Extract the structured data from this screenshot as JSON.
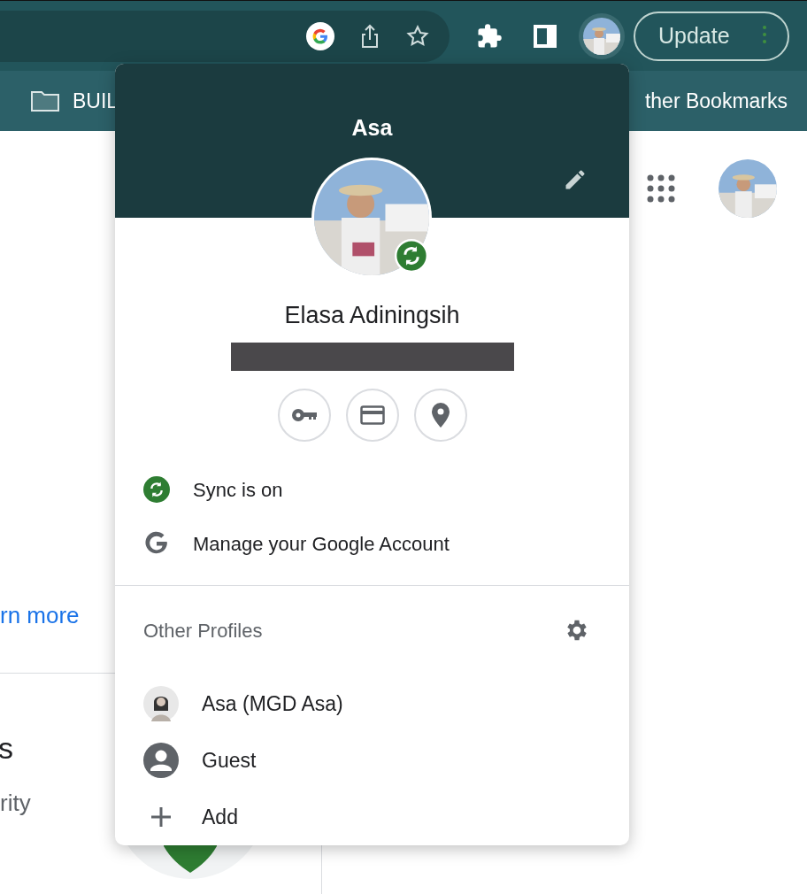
{
  "toolbar": {
    "update_button": "Update"
  },
  "bookmarks_bar": {
    "items": [
      {
        "label": "BUIL",
        "kind": "folder"
      },
      {
        "label": "ther Bookmarks",
        "kind": "plain"
      }
    ]
  },
  "page": {
    "link": "rn more",
    "heading": "s",
    "subtext": "rity"
  },
  "profile_menu": {
    "profile_name": "Asa",
    "full_name": "Elasa Adiningsih",
    "sync_on": true,
    "actions": [
      {
        "label": "Sync is on",
        "kind": "sync"
      },
      {
        "label": "Manage your Google Account",
        "kind": "google"
      }
    ],
    "other_profiles_title": "Other Profiles",
    "profiles": [
      {
        "label": "Asa (MGD Asa)"
      },
      {
        "label": "Guest",
        "kind": "guest"
      },
      {
        "label": "Add",
        "kind": "add"
      }
    ]
  }
}
